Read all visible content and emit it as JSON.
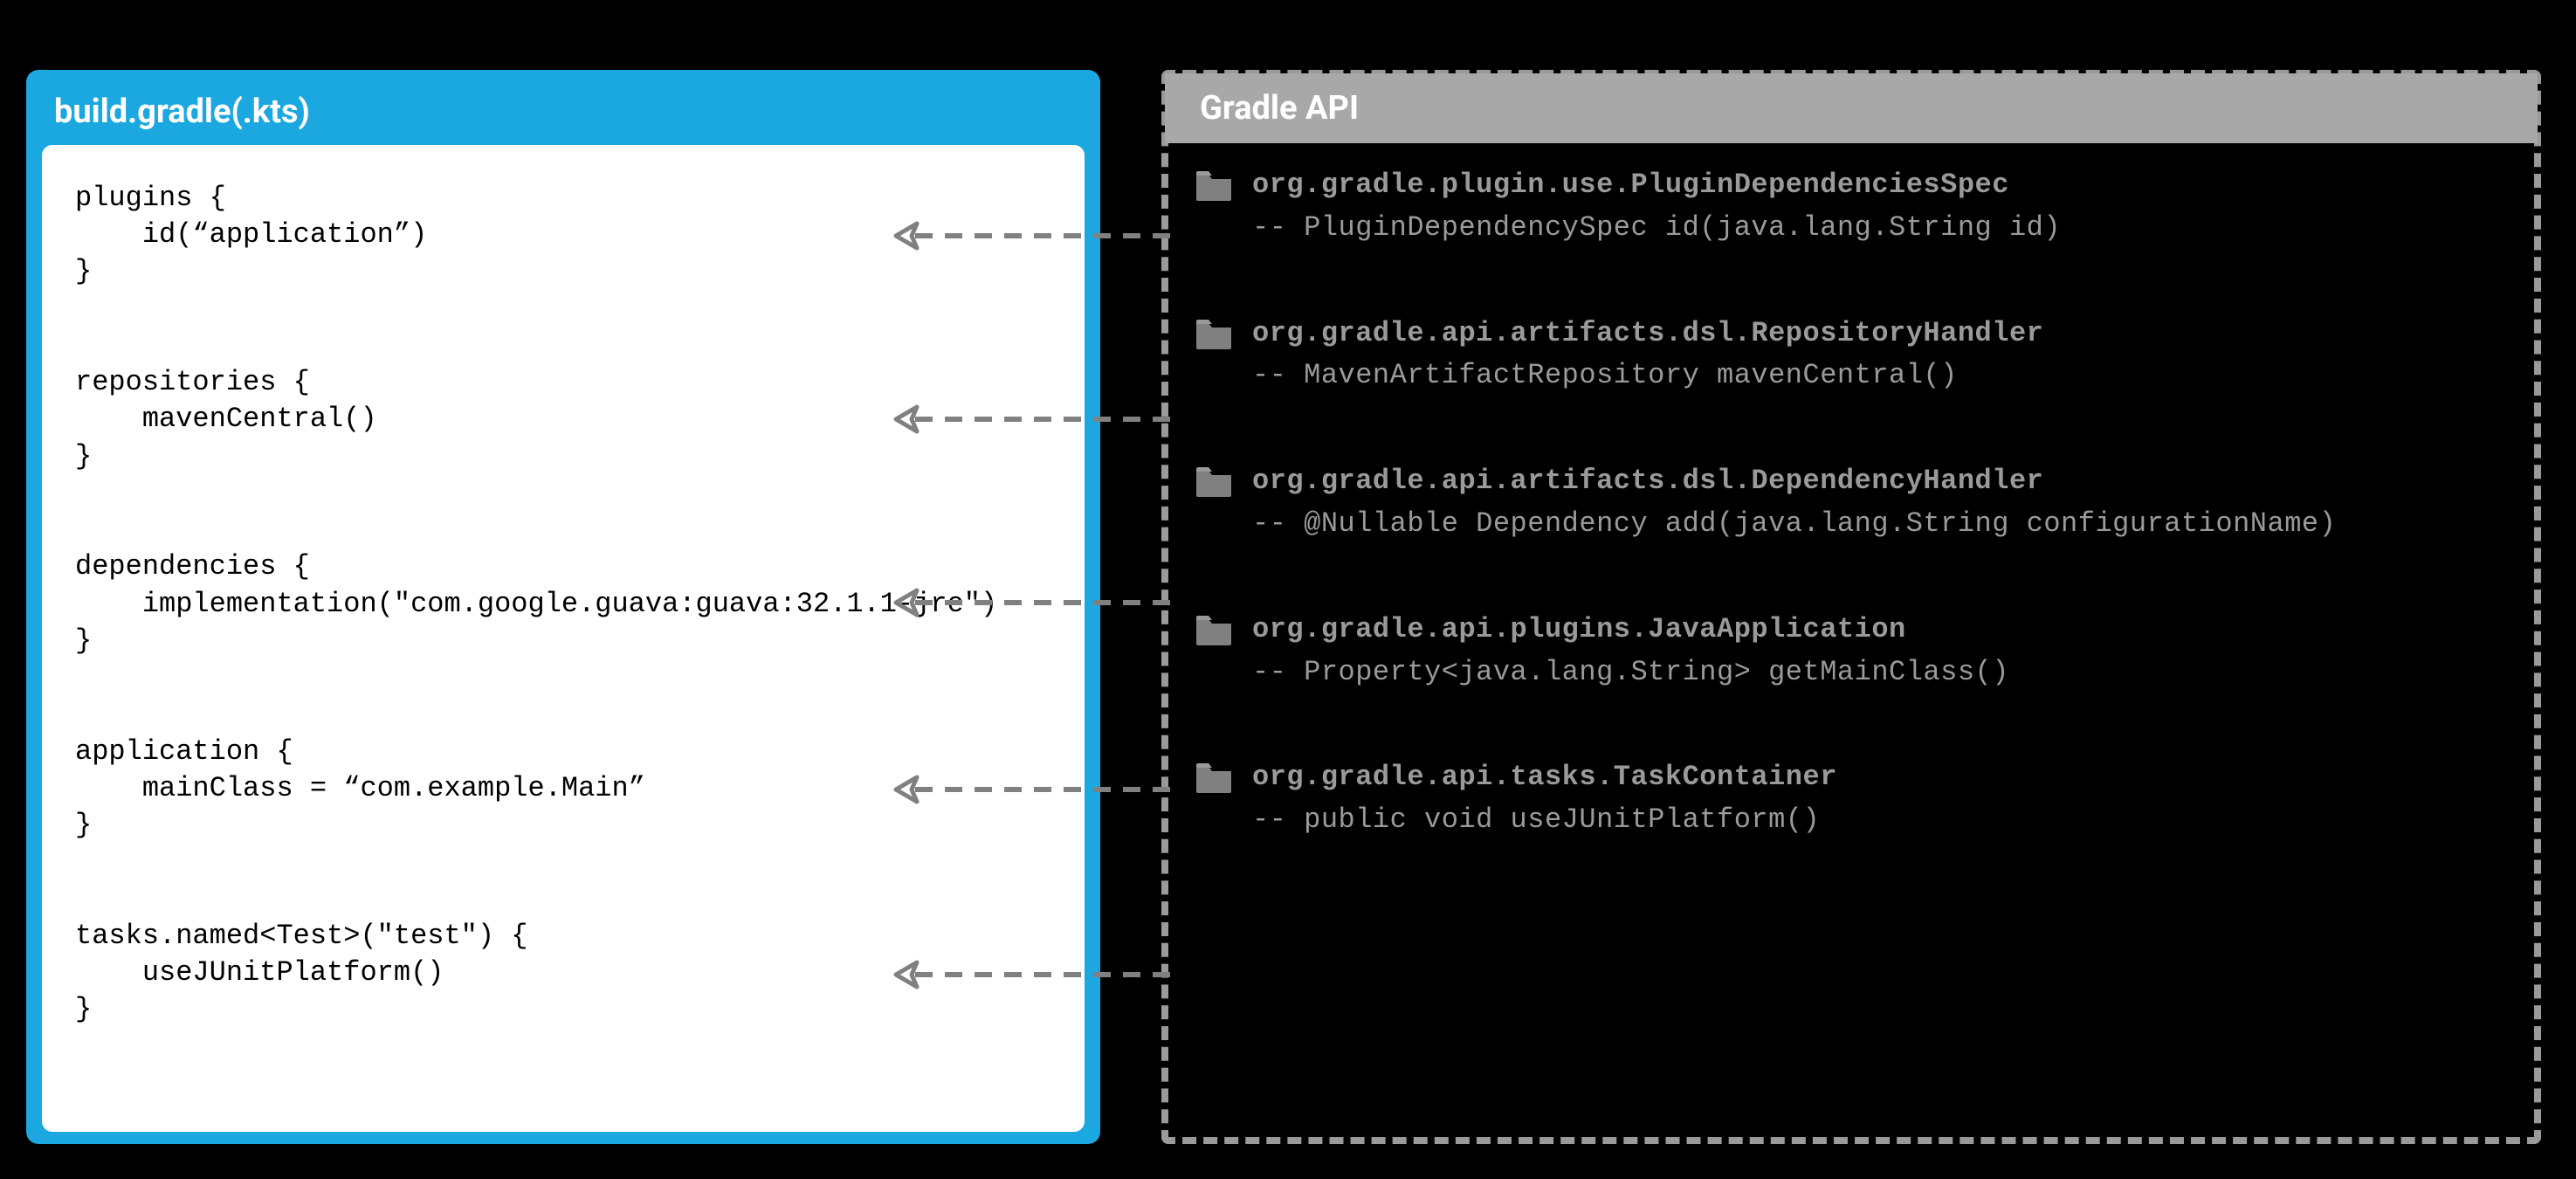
{
  "left": {
    "title": "build.gradle(.kts)",
    "code": "plugins {\n    id(“application”)\n}\n\n\nrepositories {\n    mavenCentral()\n}\n\n\ndependencies {\n    implementation(\"com.google.guava:guava:32.1.1-jre\")\n}\n\n\napplication {\n    mainClass = “com.example.Main”\n}\n\n\ntasks.named<Test>(\"test\") {\n    useJUnitPlatform()\n}"
  },
  "right": {
    "title": "Gradle API",
    "items": [
      {
        "class": "org.gradle.plugin.use.PluginDependenciesSpec",
        "method": "-- PluginDependencySpec id(java.lang.String id)"
      },
      {
        "class": "org.gradle.api.artifacts.dsl.RepositoryHandler",
        "method": "-- MavenArtifactRepository mavenCentral()"
      },
      {
        "class": "org.gradle.api.artifacts.dsl.DependencyHandler",
        "method": "-- @Nullable Dependency add(java.lang.String configurationName)"
      },
      {
        "class": "org.gradle.api.plugins.JavaApplication",
        "method": "-- Property<java.lang.String> getMainClass()"
      },
      {
        "class": "org.gradle.api.tasks.TaskContainer",
        "method": "-- public void useJUnitPlatform()"
      }
    ]
  },
  "colors": {
    "accent": "#1ba8e0",
    "muted": "#9a9a9a",
    "headerGray": "#a8a8a8"
  }
}
